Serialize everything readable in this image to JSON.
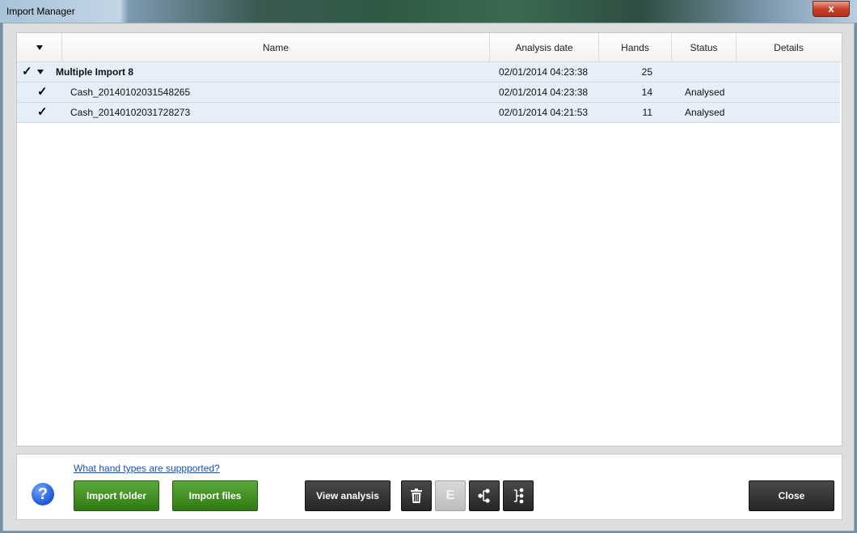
{
  "window": {
    "title": "Import Manager",
    "close_glyph": "x"
  },
  "table": {
    "columns": [
      "Name",
      "Analysis date",
      "Hands",
      "Status",
      "Details"
    ],
    "group": {
      "checked": true,
      "name": "Multiple Import 8",
      "date": "02/01/2014 04:23:38",
      "hands": "25",
      "status": ""
    },
    "rows": [
      {
        "checked": true,
        "name": "Cash_20140102031548265",
        "date": "02/01/2014 04:23:38",
        "hands": "14",
        "status": "Analysed",
        "details": ""
      },
      {
        "checked": true,
        "name": "Cash_20140102031728273",
        "date": "02/01/2014 04:21:53",
        "hands": "11",
        "status": "Analysed",
        "details": ""
      }
    ]
  },
  "footer": {
    "help_link": "What hand types are suppported?",
    "help_glyph": "?",
    "import_folder": "Import folder",
    "import_files": "Import files",
    "view_analysis": "View analysis",
    "export_glyph": "E",
    "close": "Close"
  },
  "icons": {
    "checkbox": "checkmark-icon",
    "delete": "trash-icon",
    "expand": "tree-expand-icon",
    "collapse": "tree-collapse-icon"
  },
  "colors": {
    "accent_green": "#3e8f22",
    "row_bg": "#e6eef8",
    "dark_button": "#2f2f2f",
    "link": "#1a4fb5"
  }
}
